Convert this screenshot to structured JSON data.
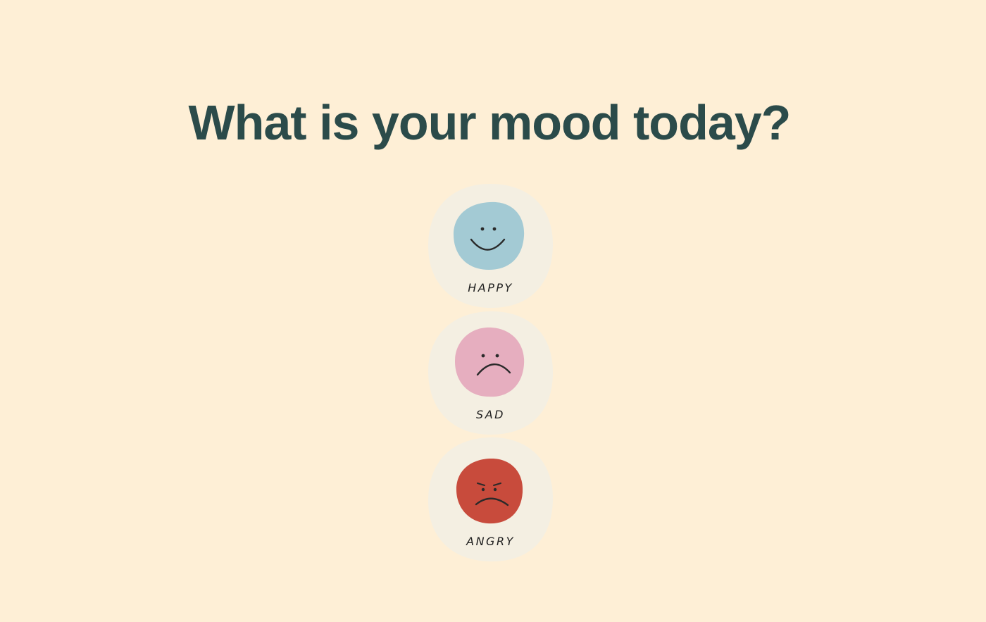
{
  "page": {
    "title": "What is your mood today?",
    "background_color": "#FEEFD6",
    "title_color": "#2B4B4A"
  },
  "moods": [
    {
      "label": "HAPPY",
      "icon": "happy-face-icon",
      "color": "#A3CAD4"
    },
    {
      "label": "SAD",
      "icon": "sad-face-icon",
      "color": "#E6AEBF"
    },
    {
      "label": "ANGRY",
      "icon": "angry-face-icon",
      "color": "#C84B3C"
    }
  ],
  "card_color": "#F4EFE2"
}
